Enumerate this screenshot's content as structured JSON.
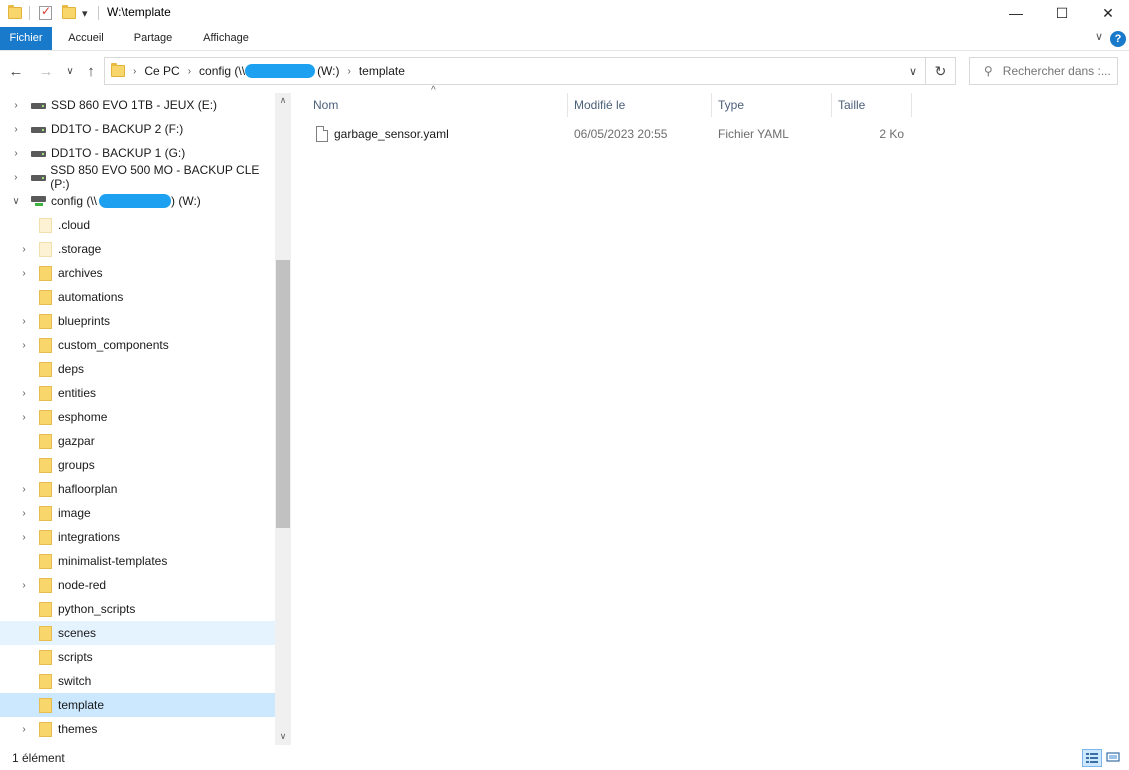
{
  "window": {
    "title": "W:\\template",
    "minimize_glyph": "—",
    "maximize_glyph": "☐",
    "close_glyph": "✕",
    "qa_dropdown_glyph": "▾"
  },
  "ribbon": {
    "tabs": [
      "Fichier",
      "Accueil",
      "Partage",
      "Affichage"
    ],
    "help_glyph": "?",
    "expand_glyph": "∨"
  },
  "nav": {
    "back_glyph": "←",
    "forward_glyph": "→",
    "recent_glyph": "∨",
    "up_glyph": "↑"
  },
  "address": {
    "crumbs": [
      "Ce PC",
      "config (\\\\",
      "(W:)",
      "template"
    ],
    "dropdown_glyph": "∨",
    "refresh_glyph": "↻"
  },
  "search": {
    "placeholder": "Rechercher dans :..."
  },
  "tree": [
    {
      "label": "SSD 860 EVO 1TB - JEUX (E:)",
      "kind": "drive",
      "expand": "›"
    },
    {
      "label": "DD1TO - BACKUP 2 (F:)",
      "kind": "drive",
      "expand": "›"
    },
    {
      "label": "DD1TO - BACKUP 1 (G:)",
      "kind": "drive",
      "expand": "›"
    },
    {
      "label": "SSD 850 EVO 500 MO - BACKUP CLE (P:)",
      "kind": "drive",
      "expand": "›"
    },
    {
      "label_prefix": "config (\\\\",
      "label_suffix": ") (W:)",
      "kind": "network",
      "expand": "∨"
    },
    {
      "label": ".cloud",
      "kind": "folder-faded",
      "expand": ""
    },
    {
      "label": ".storage",
      "kind": "folder-faded",
      "expand": "›"
    },
    {
      "label": "archives",
      "kind": "folder",
      "expand": "›"
    },
    {
      "label": "automations",
      "kind": "folder",
      "expand": ""
    },
    {
      "label": "blueprints",
      "kind": "folder",
      "expand": "›"
    },
    {
      "label": "custom_components",
      "kind": "folder",
      "expand": "›"
    },
    {
      "label": "deps",
      "kind": "folder",
      "expand": ""
    },
    {
      "label": "entities",
      "kind": "folder",
      "expand": "›"
    },
    {
      "label": "esphome",
      "kind": "folder",
      "expand": "›"
    },
    {
      "label": "gazpar",
      "kind": "folder",
      "expand": ""
    },
    {
      "label": "groups",
      "kind": "folder",
      "expand": ""
    },
    {
      "label": "hafloorplan",
      "kind": "folder",
      "expand": "›"
    },
    {
      "label": "image",
      "kind": "folder",
      "expand": "›"
    },
    {
      "label": "integrations",
      "kind": "folder",
      "expand": "›"
    },
    {
      "label": "minimalist-templates",
      "kind": "folder",
      "expand": ""
    },
    {
      "label": "node-red",
      "kind": "folder",
      "expand": "›"
    },
    {
      "label": "python_scripts",
      "kind": "folder",
      "expand": ""
    },
    {
      "label": "scenes",
      "kind": "folder",
      "expand": "",
      "state": "hover"
    },
    {
      "label": "scripts",
      "kind": "folder",
      "expand": ""
    },
    {
      "label": "switch",
      "kind": "folder",
      "expand": ""
    },
    {
      "label": "template",
      "kind": "folder",
      "expand": "",
      "state": "selected"
    },
    {
      "label": "themes",
      "kind": "folder",
      "expand": "›"
    }
  ],
  "scroll": {
    "up_glyph": "∧",
    "down_glyph": "∨"
  },
  "columns": [
    "Nom",
    "Modifié le",
    "Type",
    "Taille"
  ],
  "sort_glyph": "^",
  "files": [
    {
      "name": "garbage_sensor.yaml",
      "modified": "06/05/2023 20:55",
      "type": "Fichier YAML",
      "size": "2 Ko"
    }
  ],
  "status": {
    "count": "1 élément"
  },
  "colors": {
    "accent": "#1979ca",
    "selected": "#cce8ff",
    "hover": "#e5f3ff",
    "folder": "#f9d66b",
    "redaction": "#1ea0f0"
  }
}
